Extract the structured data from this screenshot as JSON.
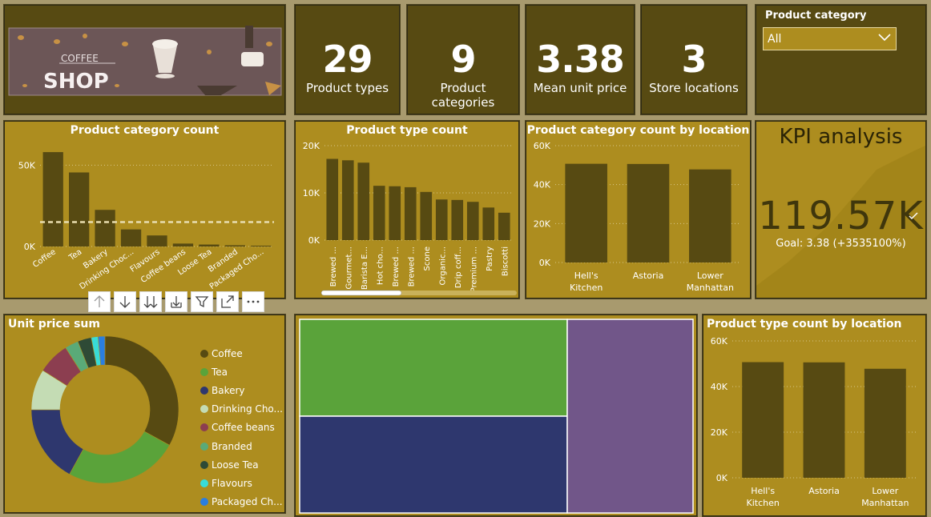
{
  "logo": {
    "top_text": "COFFEE",
    "main_text": "SHOP"
  },
  "kpis": [
    {
      "value": "29",
      "label": "Product types"
    },
    {
      "value": "9",
      "label": "Product categories"
    },
    {
      "value": "3.38",
      "label": "Mean unit price"
    },
    {
      "value": "3",
      "label": "Store locations"
    }
  ],
  "slicer": {
    "title": "Product category",
    "selected": "All"
  },
  "kpi_analysis": {
    "title": "KPI analysis",
    "value": "119.57K",
    "goal": "Goal: 3.38 (+3535100%)"
  },
  "toolbar_icons": [
    "arrow-up-icon",
    "arrow-down-icon",
    "double-arrow-down-icon",
    "expand-down-icon",
    "filter-icon",
    "focus-mode-icon",
    "more-options-icon"
  ],
  "colors": {
    "dark_tile": "#574a12",
    "gold_tile": "#ad8d1f",
    "bar": "#574a12",
    "background": "#a89a6e"
  },
  "chart_data": [
    {
      "id": "category_count",
      "type": "bar",
      "title": "Product category count",
      "categories": [
        "Coffee",
        "Tea",
        "Bakery",
        "Drinking Choc...",
        "Flavours",
        "Coffee beans",
        "Loose Tea",
        "Branded",
        "Packaged Cho..."
      ],
      "values": [
        58000,
        45500,
        22500,
        10500,
        6800,
        1800,
        1200,
        750,
        500
      ],
      "y_ticks": [
        "0K",
        "50K"
      ],
      "ylim": [
        0,
        60000
      ],
      "average_line": 15000
    },
    {
      "id": "type_count",
      "type": "bar",
      "title": "Product type count",
      "categories": [
        "Brewed ...",
        "Gourmet...",
        "Barista E...",
        "Hot cho...",
        "Brewed ...",
        "Brewed ...",
        "Scone",
        "Organic...",
        "Drip coff...",
        "Premium ...",
        "Pastry",
        "Biscotti"
      ],
      "values": [
        17200,
        16900,
        16400,
        11500,
        11400,
        11200,
        10200,
        8600,
        8500,
        8100,
        6900,
        5800
      ],
      "y_ticks": [
        "0K",
        "10K",
        "20K"
      ],
      "ylim": [
        0,
        20000
      ]
    },
    {
      "id": "category_by_location",
      "type": "bar",
      "title": "Product category count by location",
      "categories": [
        "Hell's Kitchen",
        "Astoria",
        "Lower Manhattan"
      ],
      "values": [
        50700,
        50600,
        47800
      ],
      "y_ticks": [
        "0K",
        "20K",
        "40K",
        "60K"
      ],
      "ylim": [
        0,
        60000
      ]
    },
    {
      "id": "type_by_location",
      "type": "bar",
      "title": "Product type count by location",
      "categories": [
        "Hell's Kitchen",
        "Astoria",
        "Lower Manhattan"
      ],
      "values": [
        50700,
        50600,
        47800
      ],
      "y_ticks": [
        "0K",
        "20K",
        "40K",
        "60K"
      ],
      "ylim": [
        0,
        60000
      ]
    },
    {
      "id": "unit_price_sum",
      "type": "pie",
      "title": "Unit price sum",
      "categories": [
        "Coffee",
        "Tea",
        "Bakery",
        "Drinking Cho...",
        "Coffee beans",
        "Branded",
        "Loose Tea",
        "Flavours",
        "Packaged Ch..."
      ],
      "values": [
        33,
        25,
        17,
        9,
        7,
        3,
        3,
        1.5,
        1.5
      ],
      "colors": [
        "#574a12",
        "#5aa33a",
        "#2e376e",
        "#c4dcb4",
        "#8c3e50",
        "#5aaa78",
        "#2e4a36",
        "#38dcd8",
        "#2a7ee0"
      ]
    },
    {
      "id": "treemap",
      "type": "heatmap",
      "values": [
        38,
        38,
        24
      ],
      "colors": [
        "#5aa33a",
        "#2e376e",
        "#715689"
      ]
    }
  ]
}
